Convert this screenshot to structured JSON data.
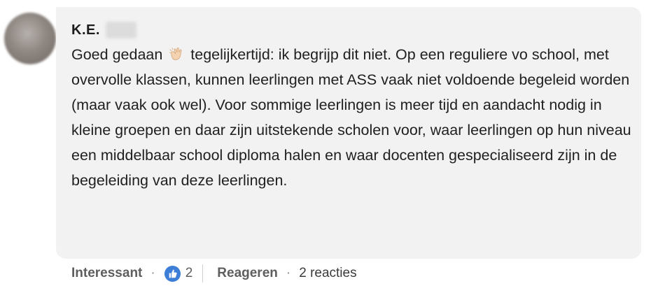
{
  "comment": {
    "author": "K.E.",
    "text_before_emoji": "Goed gedaan ",
    "emoji": "clapping-hands",
    "text_after_emoji": " tegelijkertijd: ik begrijp dit niet. Op een reguliere vo school, met overvolle klassen, kunnen leerlingen met ASS vaak niet voldoende begeleid worden (maar vaak ook wel). Voor sommige leerlingen is meer tijd en aandacht nodig in kleine groepen en daar zijn uitstekende scholen voor, waar leerlingen op hun niveau een middelbaar school diploma halen en waar docenten gespecialiseerd zijn in de begeleiding van deze leerlingen."
  },
  "actions": {
    "reaction_label": "Interessant",
    "separator": "·",
    "reaction_icon": "like-icon",
    "reaction_count": "2",
    "reply_label": "Reageren",
    "replies_text": "2 reacties"
  },
  "colors": {
    "bubble_bg": "#f2f2f2",
    "like_blue": "#3d7fd6",
    "text": "#1f1f1f",
    "muted": "#5e5e5e"
  }
}
